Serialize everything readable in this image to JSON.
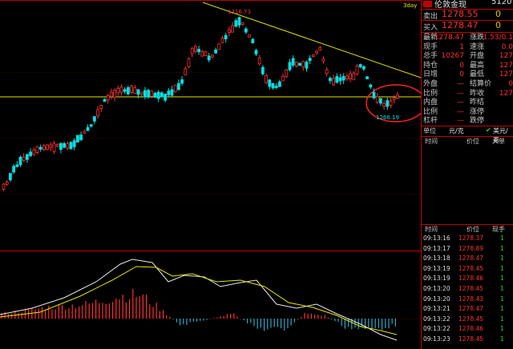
{
  "chart": {
    "period_label": "3day",
    "peak_label": "1316.73",
    "low_label": "1266.19"
  },
  "quote": {
    "title": "伦敦金现",
    "code": "5120",
    "sell_label": "卖出",
    "sell_price": "1278.55",
    "sell_vol": "0",
    "buy_label": "买入",
    "buy_price": "1278.47",
    "buy_vol": "0",
    "fields": [
      {
        "label": "最新",
        "value": "1278.47",
        "label2": "涨跌",
        "value2": "1.53/0.1"
      },
      {
        "label": "现手",
        "value": "1",
        "label2": "速涨",
        "value2": "0.0"
      },
      {
        "label": "总手",
        "value": "10267",
        "label2": "开盘",
        "value2": "127"
      },
      {
        "label": "持仓",
        "value": "0",
        "label2": "最高",
        "value2": "127"
      },
      {
        "label": "日增",
        "value": "0",
        "label2": "最低",
        "value2": "127"
      },
      {
        "label": "外盘",
        "value": "—",
        "label2": "结算价",
        "value2": "0"
      },
      {
        "label": "比例",
        "value": "—",
        "label2": "昨收",
        "value2": "127"
      },
      {
        "label": "内盘",
        "value": "—",
        "label2": "昨结",
        "value2": ""
      },
      {
        "label": "比例",
        "value": "—",
        "label2": "涨停",
        "value2": ""
      },
      {
        "label": "杠杆",
        "value": "—",
        "label2": "跌停",
        "value2": ""
      }
    ],
    "unit_label": "单位",
    "unit_value": "元/克",
    "currency_label": "美元/盎",
    "header1": {
      "time": "时间",
      "price": "价位",
      "lots": "大单"
    },
    "header2": {
      "time": "时间",
      "price": "价位",
      "lots": "现手"
    },
    "ticks": [
      {
        "time": "09:13:16",
        "price": "1278.37",
        "vol": "1"
      },
      {
        "time": "09:13:17",
        "price": "1278.89",
        "vol": "1"
      },
      {
        "time": "09:13:18",
        "price": "1278.47",
        "vol": "1"
      },
      {
        "time": "09:13:19",
        "price": "1278.45",
        "vol": "1"
      },
      {
        "time": "09:13:19",
        "price": "1278.46",
        "vol": "1"
      },
      {
        "time": "09:13:20",
        "price": "1278.45",
        "vol": "1"
      },
      {
        "time": "09:13:20",
        "price": "1278.43",
        "vol": "1"
      },
      {
        "time": "09:13:21",
        "price": "1278.47",
        "vol": "1"
      },
      {
        "time": "09:13:22",
        "price": "1278.45",
        "vol": "1"
      },
      {
        "time": "09:13:22",
        "price": "1278.46",
        "vol": "1"
      },
      {
        "time": "09:13:23",
        "price": "1278.45",
        "vol": "1"
      }
    ]
  },
  "colors": {
    "up": "#ff3030",
    "down": "#00e0e0",
    "frame": "#c00000",
    "trend": "#e6e600",
    "circle": "#ff2020"
  }
}
